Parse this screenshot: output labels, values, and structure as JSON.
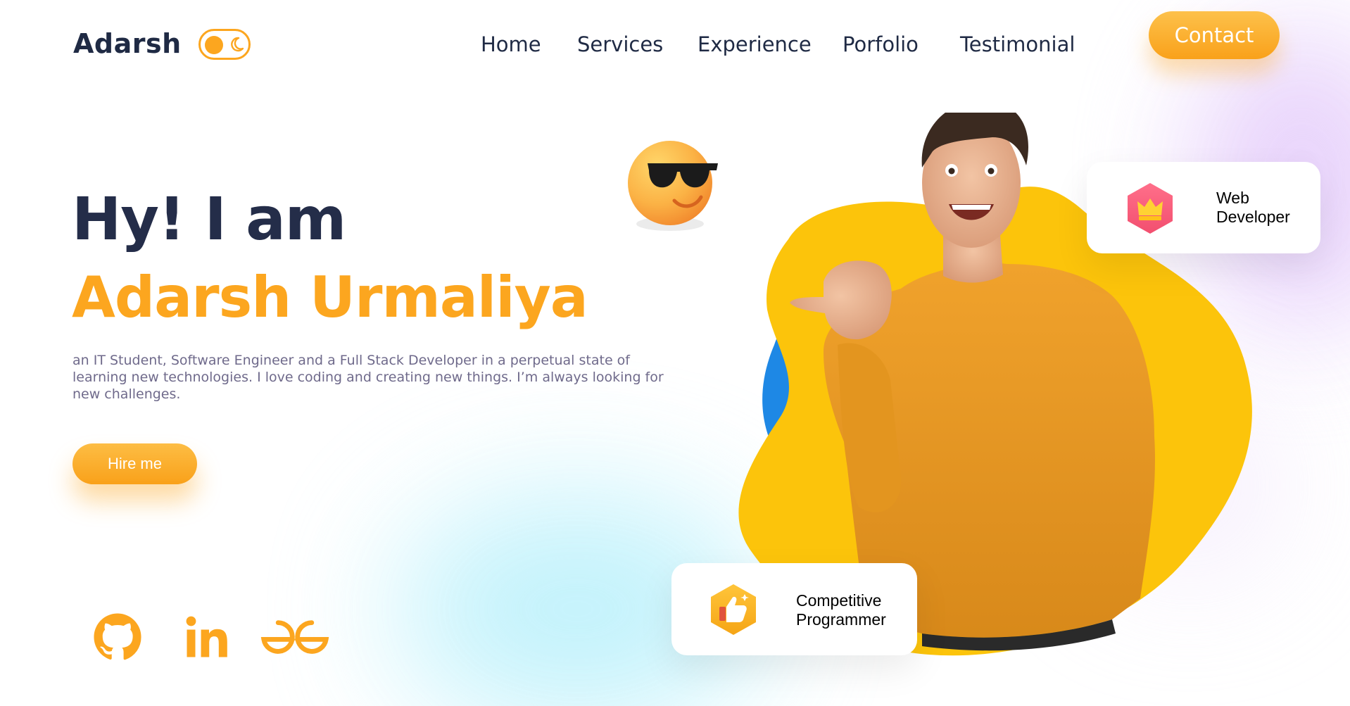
{
  "nav": {
    "logo": "Adarsh",
    "links": [
      "Home",
      "Services",
      "Experience",
      "Porfolio",
      "Testimonial"
    ],
    "contact_label": "Contact"
  },
  "hero": {
    "greeting": "Hy! I am",
    "name": "Adarsh Urmaliya",
    "bio": "an IT Student, Software Engineer and a Full Stack Developer in a perpetual state of learning new technologies. I love coding and creating new things. I’m always looking for new challenges.",
    "hire_label": "Hire me"
  },
  "badges": {
    "web": "Web Developer",
    "web_line1": "Web",
    "web_line2": "Developer",
    "competitive_line1": "Competitive",
    "competitive_line2": "Programmer"
  },
  "social": {
    "icons": [
      "github-icon",
      "linkedin-icon",
      "geeksforgeeks-icon"
    ]
  },
  "colors": {
    "accent": "#fca61f",
    "heading": "#242d49",
    "body_text": "#6f6a8b",
    "blob_yellow": "#fcc40b",
    "blob_blue": "#1e88e5"
  }
}
